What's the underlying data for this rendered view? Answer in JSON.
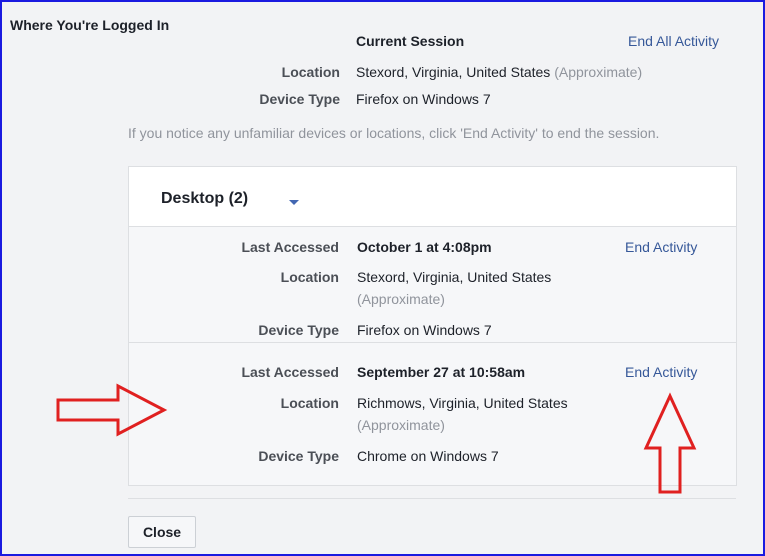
{
  "section_title": "Where You're Logged In",
  "current_session": {
    "heading": "Current Session",
    "end_all_label": "End All Activity",
    "location_label": "Location",
    "location_value": "Stexord, Virginia, United States",
    "approx": "(Approximate)",
    "device_label": "Device Type",
    "device_value": "Firefox on Windows 7"
  },
  "notice": "If you notice any unfamiliar devices or locations, click 'End Activity' to end the session.",
  "desktop": {
    "title": "Desktop (2)",
    "sessions": [
      {
        "last_label": "Last Accessed",
        "last_value": "October 1 at 4:08pm",
        "end_label": "End Activity",
        "location_label": "Location",
        "location_value": "Stexord, Virginia, United States",
        "approx": "(Approximate)",
        "device_label": "Device Type",
        "device_value": "Firefox on Windows 7"
      },
      {
        "last_label": "Last Accessed",
        "last_value": "September 27 at 10:58am",
        "end_label": "End Activity",
        "location_label": "Location",
        "location_value": "Richmows, Virginia, United States",
        "approx": "(Approximate)",
        "device_label": "Device Type",
        "device_value": "Chrome on Windows 7"
      }
    ]
  },
  "close_label": "Close",
  "colors": {
    "link": "#365899",
    "arrow": "#e02020",
    "frame_border": "#1a1ae0"
  }
}
